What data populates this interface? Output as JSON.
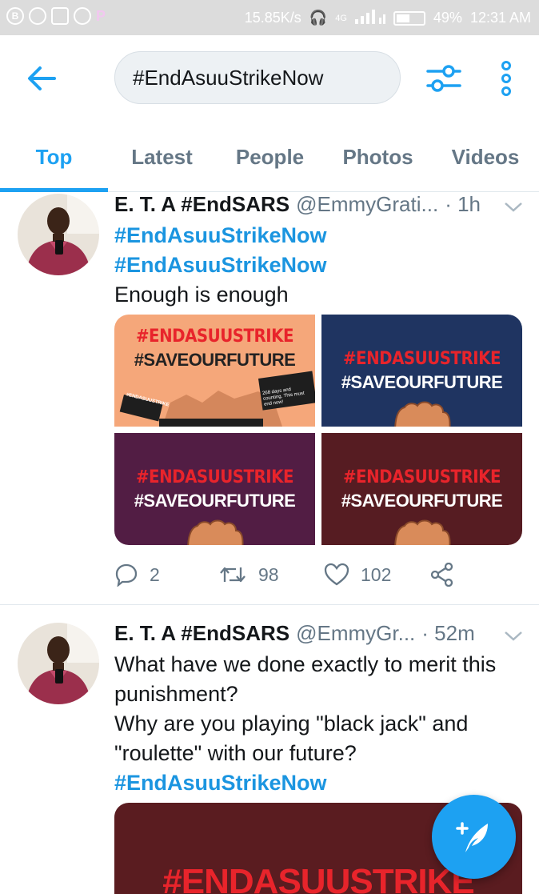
{
  "status_bar": {
    "speed": "15.85K/s",
    "network": "4G",
    "battery": "49%",
    "time": "12:31 AM",
    "battery_level": 0.49
  },
  "search": {
    "query": "#EndAsuuStrikeNow"
  },
  "tabs": [
    {
      "label": "Top",
      "active": true
    },
    {
      "label": "Latest",
      "active": false
    },
    {
      "label": "People",
      "active": false
    },
    {
      "label": "Photos",
      "active": false
    },
    {
      "label": "Videos",
      "active": false
    }
  ],
  "tweets": [
    {
      "name": "E. T. A #EndSARS",
      "handle": "@EmmyGrati...",
      "time": "· 1h",
      "lines": [
        {
          "text": "#EndAsuuStrikeNow",
          "tag": true
        },
        {
          "text": "#EndAsuuStrikeNow",
          "tag": true
        },
        {
          "text": "Enough is enough",
          "tag": false
        }
      ],
      "media": [
        {
          "line1": "#ENDASUUSTRIKE",
          "line2": "#SAVEOURFUTURE",
          "bg": "#f5a77a",
          "sign1": "#ENDASUUSTRIKE",
          "sign2": "268 days and counting. This must end now!"
        },
        {
          "line1": "#ENDASUUSTRIKE",
          "line2": "#SAVEOURFUTURE",
          "bg": "#1f3461"
        },
        {
          "line1": "#ENDASUUSTRIKE",
          "line2": "#SAVEOURFUTURE",
          "bg": "#521d44"
        },
        {
          "line1": "#ENDASUUSTRIKE",
          "line2": "#SAVEOURFUTURE",
          "bg": "#561c22"
        }
      ],
      "replies": "2",
      "retweets": "98",
      "likes": "102"
    },
    {
      "name": "E. T. A #EndSARS",
      "handle": "@EmmyGr...",
      "time": "· 52m",
      "lines": [
        {
          "text": "What have we done exactly to merit this",
          "tag": false
        },
        {
          "text": "punishment?",
          "tag": false
        },
        {
          "text": "Why are you playing \"black jack\" and",
          "tag": false
        },
        {
          "text": "\"roulette\" with our future?",
          "tag": false
        },
        {
          "text": "#EndAsuuStrikeNow",
          "tag": true
        }
      ],
      "media_text": "#ENDASUUSTRIKE"
    }
  ],
  "colors": {
    "accent": "#1da1f2",
    "hashtag": "#1b95e0",
    "secondary_text": "#657786",
    "hashtag_red": "#e8242b"
  }
}
